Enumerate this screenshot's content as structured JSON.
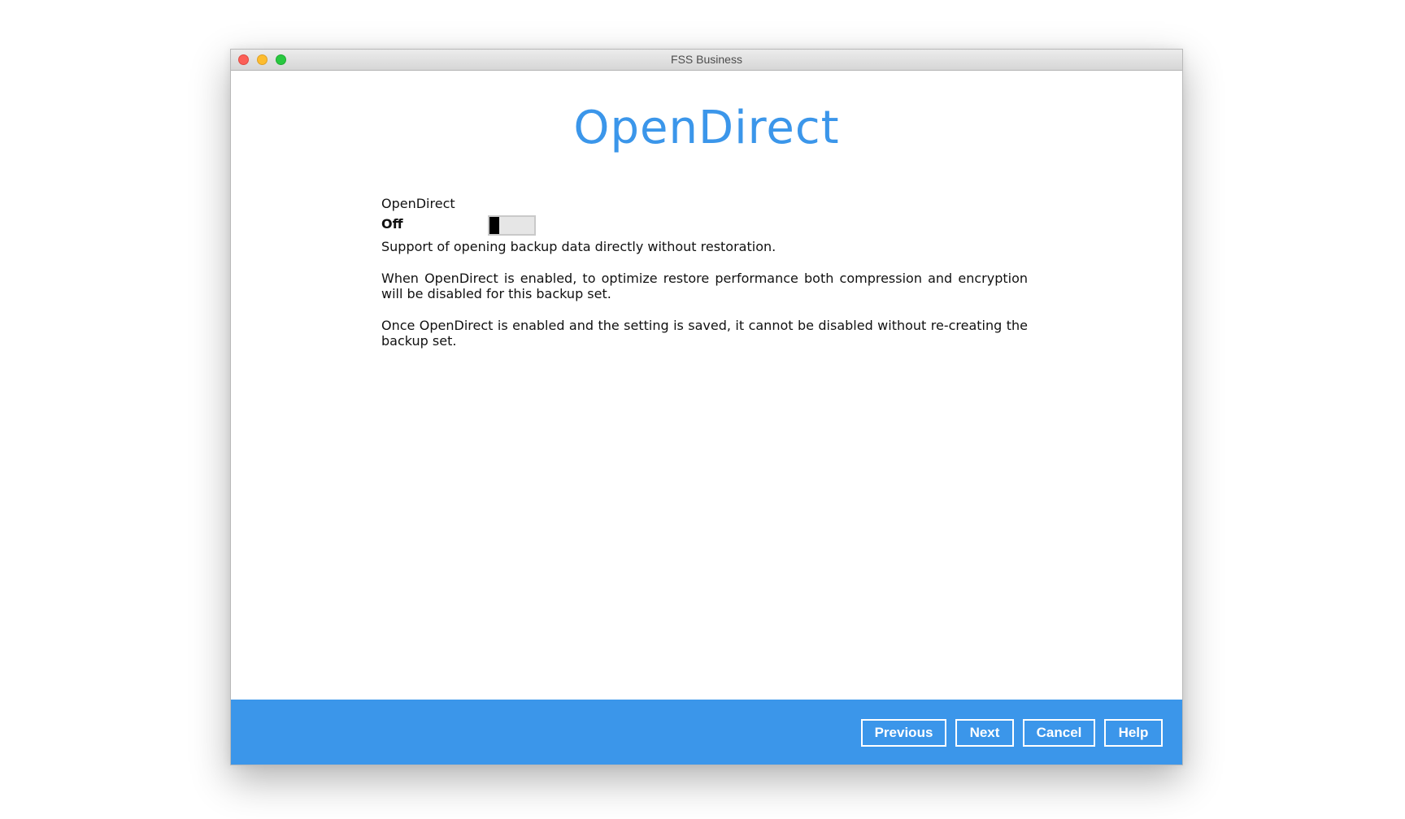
{
  "window": {
    "title": "FSS Business"
  },
  "page": {
    "title": "OpenDirect"
  },
  "setting": {
    "label": "OpenDirect",
    "state": "Off",
    "enabled": false
  },
  "description": {
    "line1": "Support of opening backup data directly without restoration.",
    "line2": "When OpenDirect is enabled, to optimize restore performance both compression and encryption will be disabled for this backup set.",
    "line3": "Once OpenDirect is enabled and the setting is saved, it cannot be disabled without re-creating the backup set."
  },
  "footer": {
    "previous_label": "Previous",
    "next_label": "Next",
    "cancel_label": "Cancel",
    "help_label": "Help"
  },
  "colors": {
    "accent": "#3b96ea",
    "toggle_track": "#e6e6e6",
    "toggle_knob": "#000000"
  }
}
